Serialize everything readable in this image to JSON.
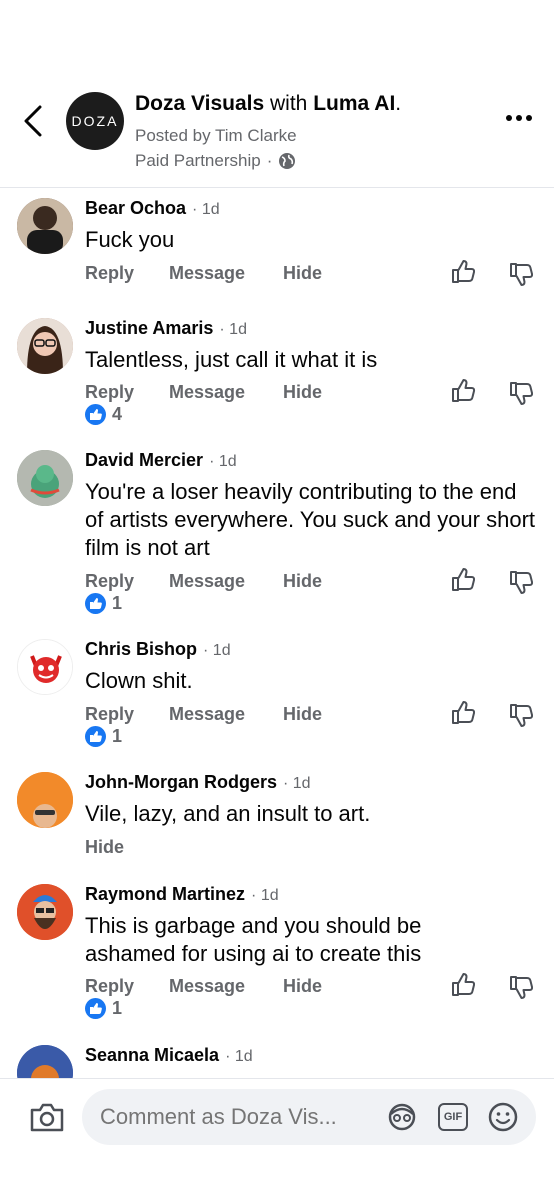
{
  "header": {
    "page_name": "Doza Visuals",
    "with_text": "with",
    "partner_name": "Luma AI",
    "title_suffix": ".",
    "avatar_text": "DOZA",
    "posted_by": "Posted by Tim Clarke",
    "partnership": "Paid Partnership",
    "separator": "·"
  },
  "actions": {
    "reply": "Reply",
    "message": "Message",
    "hide": "Hide"
  },
  "comments": [
    {
      "name": "Bear Ochoa",
      "time": "1d",
      "text": "Fuck you",
      "likes": "",
      "avatar_color": "#6b4a3a"
    },
    {
      "name": "Justine Amaris",
      "time": "1d",
      "text": "Talentless, just call it what it is",
      "likes": "4",
      "avatar_color": "#b88a7a"
    },
    {
      "name": "David Mercier",
      "time": "1d",
      "text": "You're a loser heavily contributing to the end of artists everywhere. You suck and your short film is not art",
      "likes": "1",
      "avatar_color": "#8a9a8a"
    },
    {
      "name": "Chris Bishop",
      "time": "1d",
      "text": "Clown shit.",
      "likes": "1",
      "avatar_color": "#e02a2a"
    },
    {
      "name": "John-Morgan Rodgers",
      "time": "1d",
      "text": "Vile, lazy, and an insult to art.",
      "likes": "",
      "avatar_color": "#f28a2a"
    },
    {
      "name": "Raymond Martinez",
      "time": "1d",
      "text": "This is garbage and you should be ashamed for using ai to create this",
      "likes": "1",
      "avatar_color": "#d9542a"
    },
    {
      "name": "Seanna Micaela",
      "time": "1d",
      "text": "",
      "likes": "",
      "avatar_color": "#3a5aa8"
    }
  ],
  "composer": {
    "placeholder": "Comment as Doza Vis...",
    "gif_label": "GIF"
  },
  "colors": {
    "primary_text": "#050505",
    "secondary_text": "#65676b",
    "like_blue": "#1877f2",
    "composer_bg": "#f0f2f5"
  }
}
